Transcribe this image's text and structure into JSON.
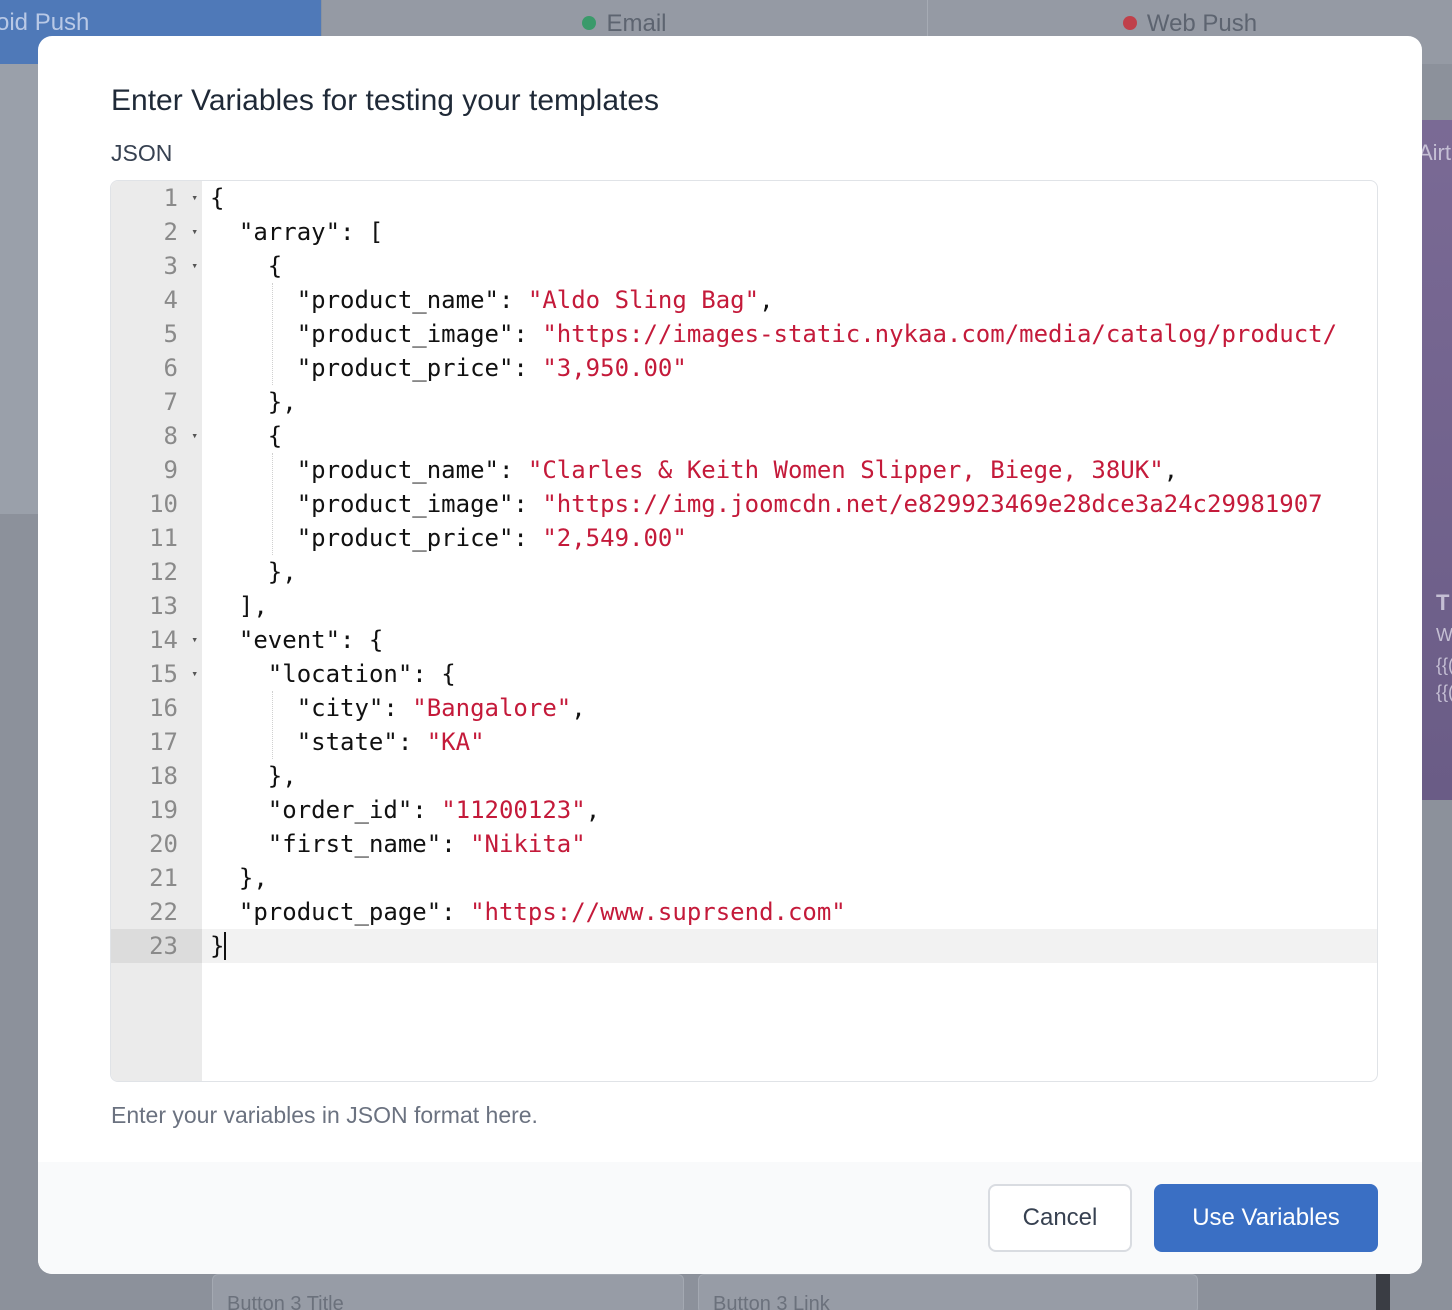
{
  "background": {
    "tabs": [
      {
        "label": "oid Push",
        "active": true
      },
      {
        "label": "Email",
        "dot_color": "#3a9a6a"
      },
      {
        "label": "Web Push",
        "dot_color": "#c0404a"
      }
    ],
    "fields": [
      "Button 3 Title",
      "Button 3 Link"
    ],
    "phone_text": [
      "Airt",
      "T",
      "W",
      "{{(",
      "{{("
    ]
  },
  "modal": {
    "title": "Enter Variables for testing your templates",
    "json_label": "JSON",
    "help_text": "Enter your variables in JSON format here.",
    "cancel_label": "Cancel",
    "use_label": "Use Variables"
  },
  "editor": {
    "active_line": 23,
    "lines": [
      {
        "n": "1",
        "fold": true,
        "indent": 0,
        "parts": [
          {
            "t": "{"
          }
        ]
      },
      {
        "n": "2",
        "fold": true,
        "indent": 1,
        "parts": [
          {
            "t": "\"array\": ["
          }
        ]
      },
      {
        "n": "3",
        "fold": true,
        "indent": 2,
        "parts": [
          {
            "t": "{"
          }
        ]
      },
      {
        "n": "4",
        "fold": false,
        "indent": 3,
        "parts": [
          {
            "t": "\"product_name\": "
          },
          {
            "t": "\"Aldo Sling Bag\"",
            "s": true
          },
          {
            "t": ","
          }
        ]
      },
      {
        "n": "5",
        "fold": false,
        "indent": 3,
        "parts": [
          {
            "t": "\"product_image\": "
          },
          {
            "t": "\"https://images-static.nykaa.com/media/catalog/product/",
            "s": true
          }
        ]
      },
      {
        "n": "6",
        "fold": false,
        "indent": 3,
        "parts": [
          {
            "t": "\"product_price\": "
          },
          {
            "t": "\"3,950.00\"",
            "s": true
          }
        ]
      },
      {
        "n": "7",
        "fold": false,
        "indent": 2,
        "parts": [
          {
            "t": "},"
          }
        ]
      },
      {
        "n": "8",
        "fold": true,
        "indent": 2,
        "parts": [
          {
            "t": "{"
          }
        ]
      },
      {
        "n": "9",
        "fold": false,
        "indent": 3,
        "parts": [
          {
            "t": "\"product_name\": "
          },
          {
            "t": "\"Clarles & Keith Women Slipper, Biege, 38UK\"",
            "s": true
          },
          {
            "t": ","
          }
        ]
      },
      {
        "n": "10",
        "fold": false,
        "indent": 3,
        "parts": [
          {
            "t": "\"product_image\": "
          },
          {
            "t": "\"https://img.joomcdn.net/e829923469e28dce3a24c29981907",
            "s": true
          }
        ]
      },
      {
        "n": "11",
        "fold": false,
        "indent": 3,
        "parts": [
          {
            "t": "\"product_price\": "
          },
          {
            "t": "\"2,549.00\"",
            "s": true
          }
        ]
      },
      {
        "n": "12",
        "fold": false,
        "indent": 2,
        "parts": [
          {
            "t": "},"
          }
        ]
      },
      {
        "n": "13",
        "fold": false,
        "indent": 1,
        "parts": [
          {
            "t": "],"
          }
        ]
      },
      {
        "n": "14",
        "fold": true,
        "indent": 1,
        "parts": [
          {
            "t": "\"event\": {"
          }
        ]
      },
      {
        "n": "15",
        "fold": true,
        "indent": 2,
        "parts": [
          {
            "t": "\"location\": {"
          }
        ]
      },
      {
        "n": "16",
        "fold": false,
        "indent": 3,
        "parts": [
          {
            "t": "\"city\": "
          },
          {
            "t": "\"Bangalore\"",
            "s": true
          },
          {
            "t": ","
          }
        ]
      },
      {
        "n": "17",
        "fold": false,
        "indent": 3,
        "parts": [
          {
            "t": "\"state\": "
          },
          {
            "t": "\"KA\"",
            "s": true
          }
        ]
      },
      {
        "n": "18",
        "fold": false,
        "indent": 2,
        "parts": [
          {
            "t": "},"
          }
        ]
      },
      {
        "n": "19",
        "fold": false,
        "indent": 2,
        "parts": [
          {
            "t": "\"order_id\": "
          },
          {
            "t": "\"11200123\"",
            "s": true
          },
          {
            "t": ","
          }
        ]
      },
      {
        "n": "20",
        "fold": false,
        "indent": 2,
        "parts": [
          {
            "t": "\"first_name\": "
          },
          {
            "t": "\"Nikita\"",
            "s": true
          }
        ]
      },
      {
        "n": "21",
        "fold": false,
        "indent": 1,
        "parts": [
          {
            "t": "},"
          }
        ]
      },
      {
        "n": "22",
        "fold": false,
        "indent": 1,
        "parts": [
          {
            "t": "\"product_page\": "
          },
          {
            "t": "\"https://www.suprsend.com\"",
            "s": true
          }
        ]
      },
      {
        "n": "23",
        "fold": false,
        "indent": 0,
        "parts": [
          {
            "t": "}"
          }
        ]
      }
    ]
  }
}
